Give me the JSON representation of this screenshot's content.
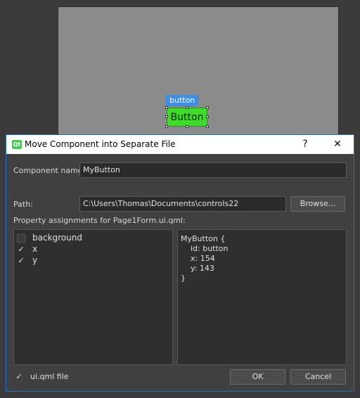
{
  "designer": {
    "selection_tag": "button",
    "button_text": "Button"
  },
  "dialog": {
    "title": "Move Component into Separate File",
    "help_glyph": "?",
    "close_glyph": "✕",
    "app_icon_text": "Qt",
    "component_name_label": "Component name:",
    "component_name_value": "MyButton",
    "path_label": "Path:",
    "path_value": "C:\\Users\\Thomas\\Documents\\controls22",
    "browse_label": "Browse...",
    "assignments_label": "Property assignments for Page1Form.ui.qml:",
    "properties": [
      {
        "name": "background",
        "checked": false
      },
      {
        "name": "x",
        "checked": true
      },
      {
        "name": "y",
        "checked": true
      }
    ],
    "code_preview": "MyButton {\n    id: button\n    x: 154\n    y: 143\n}",
    "uiqml_checkbox_label": "ui.qml file",
    "uiqml_checked": true,
    "ok_label": "OK",
    "cancel_label": "Cancel",
    "check_glyph": "✓"
  },
  "colors": {
    "accent": "#3d8ee6",
    "button_green": "#3ddc2b",
    "dialog_bg": "#404040"
  }
}
